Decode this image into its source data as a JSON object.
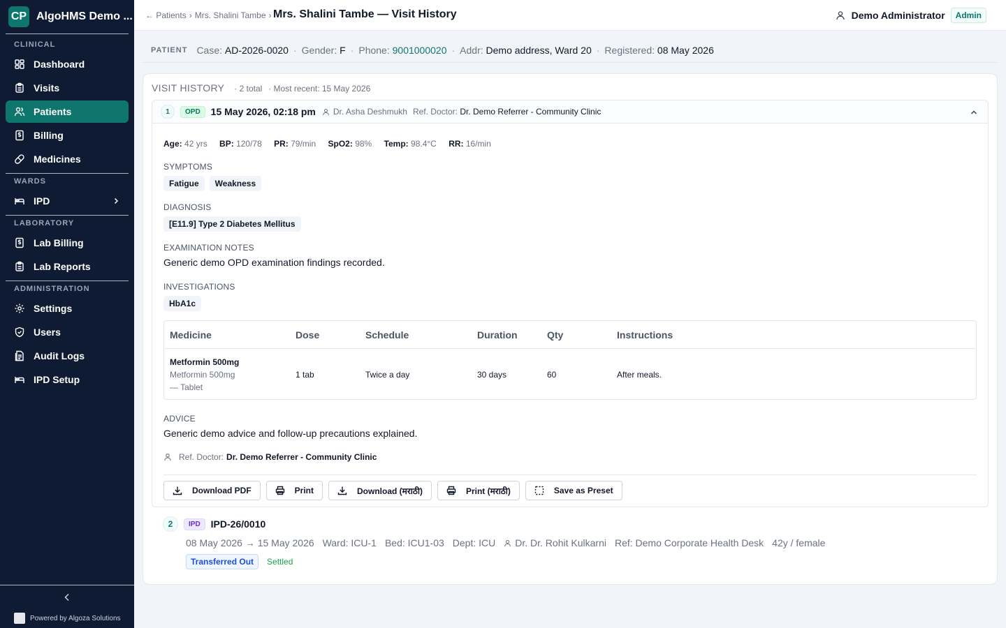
{
  "sidebar": {
    "brand_initials": "CP",
    "brand_name": "AlgoHMS Demo ...",
    "sections": {
      "clinical": "CLINICAL",
      "wards": "WARDS",
      "laboratory": "LABORATORY",
      "administration": "ADMINISTRATION"
    },
    "items": {
      "dashboard": "Dashboard",
      "visits": "Visits",
      "patients": "Patients",
      "billing": "Billing",
      "medicines": "Medicines",
      "ipd": "IPD",
      "lab_billing": "Lab Billing",
      "lab_reports": "Lab Reports",
      "settings": "Settings",
      "users": "Users",
      "audit_logs": "Audit Logs",
      "ipd_setup": "IPD Setup"
    },
    "active": "patients",
    "powered_by": "Powered by Algoza Solutions"
  },
  "header": {
    "back": "← Patients",
    "sep": "›",
    "crumb_patient": "Mrs. Shalini Tambe",
    "title": "Mrs. Shalini Tambe — Visit History",
    "user_name": "Demo Administrator",
    "role": "Admin"
  },
  "patient": {
    "label": "PATIENT",
    "case_label": "Case:",
    "case": "AD-2026-0020",
    "gender_label": "Gender:",
    "gender": "F",
    "phone_label": "Phone:",
    "phone": "9001000020",
    "addr_label": "Addr:",
    "addr": "Demo address, Ward 20",
    "registered_label": "Registered:",
    "registered": "08 May 2026",
    "sep": "·"
  },
  "visit_history": {
    "title": "VISIT HISTORY",
    "total": "· 2 total",
    "most_recent": "· Most recent: 15 May 2026"
  },
  "visit1": {
    "index": "1",
    "type": "OPD",
    "datetime": "15 May 2026, 02:18 pm",
    "doctor": "Dr. Asha Deshmukh",
    "ref_label": "Ref. Doctor:",
    "ref_doctor": "Dr. Demo Referrer - Community Clinic",
    "vitals": {
      "age_k": "Age:",
      "age_v": "42 yrs",
      "bp_k": "BP:",
      "bp_v": "120/78",
      "pr_k": "PR:",
      "pr_v": "79/min",
      "spo2_k": "SpO2:",
      "spo2_v": "98%",
      "temp_k": "Temp:",
      "temp_v": "98.4°C",
      "rr_k": "RR:",
      "rr_v": "16/min"
    },
    "symptoms_label": "SYMPTOMS",
    "symptoms": [
      "Fatigue",
      "Weakness"
    ],
    "diagnosis_label": "DIAGNOSIS",
    "diagnosis": "[E11.9] Type 2 Diabetes Mellitus",
    "exam_label": "EXAMINATION NOTES",
    "exam": "Generic demo OPD examination findings recorded.",
    "investigations_label": "INVESTIGATIONS",
    "investigations": [
      "HbA1c"
    ],
    "med_columns": [
      "Medicine",
      "Dose",
      "Schedule",
      "Duration",
      "Qty",
      "Instructions"
    ],
    "medicines": [
      {
        "name": "Metformin 500mg",
        "generic": "Metformin 500mg",
        "form": "— Tablet",
        "dose": "1 tab",
        "schedule": "Twice a day",
        "duration": "30 days",
        "qty": "60",
        "instructions": "After meals."
      }
    ],
    "advice_label": "ADVICE",
    "advice": "Generic demo advice and follow-up precautions explained.",
    "ref_footer_label": "Ref. Doctor:",
    "ref_footer": "Dr. Demo Referrer - Community Clinic",
    "buttons": {
      "download_pdf": "Download PDF",
      "print": "Print",
      "download_marathi": "Download (मराठी)",
      "print_marathi": "Print (मराठी)",
      "save_preset": "Save as Preset"
    }
  },
  "visit2": {
    "index": "2",
    "type": "IPD",
    "id": "IPD-26/0010",
    "dates": "08 May 2026 → 15 May 2026",
    "ward": "Ward: ICU-1",
    "bed": "Bed: ICU1-03",
    "dept": "Dept: ICU",
    "doctor": "Dr. Dr. Rohit Kulkarni",
    "ref": "Ref: Demo Corporate Health Desk",
    "demographics": "42y / female",
    "status": "Transferred Out",
    "billing": "Settled"
  },
  "colors": {
    "sidebar_bg": "#0f1b33",
    "accent": "#0f766e"
  }
}
